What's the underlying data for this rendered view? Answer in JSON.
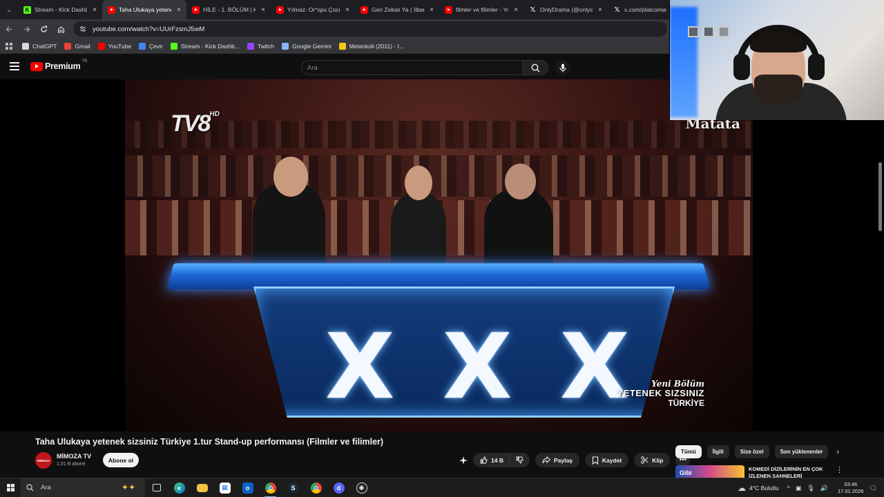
{
  "browser": {
    "tabs": [
      {
        "label": "Stream - Kick Dashb",
        "favicon": "kick",
        "active": false
      },
      {
        "label": "Taha Ulukaya yetene",
        "favicon": "youtube",
        "active": true
      },
      {
        "label": "HİLE - 1. BÖLÜM | K",
        "favicon": "youtube",
        "active": false
      },
      {
        "label": "Yılmaz: Or*spu Çocuğ",
        "favicon": "youtube",
        "active": false
      },
      {
        "label": "Geri Zekalı Ya ( İlber",
        "favicon": "youtube",
        "active": false
      },
      {
        "label": "filmler ve filimler - Yo",
        "favicon": "youtube",
        "active": false
      },
      {
        "label": "OnlyDrama (@onlyd",
        "favicon": "x",
        "active": false
      },
      {
        "label": "x.com/platcomw",
        "favicon": "x",
        "active": false
      }
    ],
    "close_glyph": "×",
    "url": "youtube.com/watch?v=UUrFzsmJ5wM",
    "bookmarks": [
      {
        "label": "ChatGPT",
        "icon": "chatgpt-icon",
        "color": "#d9d9d9"
      },
      {
        "label": "Gmail",
        "icon": "gmail-icon",
        "color": "#ea4335"
      },
      {
        "label": "YouTube",
        "icon": "youtube-icon",
        "color": "#ff0000"
      },
      {
        "label": "Çevir",
        "icon": "translate-icon",
        "color": "#4285f4"
      },
      {
        "label": "Stream - Kick Dashb...",
        "icon": "kick-icon",
        "color": "#53fc18"
      },
      {
        "label": "Twitch",
        "icon": "twitch-icon",
        "color": "#9146ff"
      },
      {
        "label": "Google Gemini",
        "icon": "gemini-icon",
        "color": "#8ab4f8"
      },
      {
        "label": "Melankoli (2011) - I...",
        "icon": "imdb-icon",
        "color": "#f5c518"
      }
    ]
  },
  "youtube": {
    "logo_text": "Premium",
    "country_code": "TR",
    "search_placeholder": "Ara",
    "video": {
      "title": "Taha Ulukaya yetenek sizsiniz Türkiye 1.tur Stand-up performansı (Filmler ve filimler)",
      "channel": "MİMOZA TV",
      "avatar_text": "MİMOZA",
      "subscribers": "1,01 B abone",
      "subscribe_label": "Abone ol",
      "likes": "14 B",
      "share_label": "Paylaş",
      "save_label": "Kaydet",
      "clip_label": "Klip",
      "overlay": {
        "channel_logo": "TV8",
        "channel_logo_suffix": "HD",
        "top_right_text": "Matata",
        "badge_line1": "Yeni Bölüm",
        "badge_line2": "YETENEK SIZSINIZ",
        "badge_line3": "TÜRKİYE"
      }
    },
    "chips": [
      {
        "label": "Tümü",
        "active": true
      },
      {
        "label": "İlgili",
        "active": false
      },
      {
        "label": "Size özel",
        "active": false
      },
      {
        "label": "Son yüklenenler",
        "active": false
      }
    ],
    "recommendation": {
      "thumb_text": "Gibi",
      "title": "KOMEDİ DİZİLERİNİN EN ÇOK İZLENEN SAHNELERİ"
    }
  },
  "taskbar": {
    "search_placeholder": "Ara",
    "apps": [
      "task-view-icon",
      "edge-icon",
      "file-explorer-icon",
      "store-icon",
      "outlook-icon",
      "chrome-icon",
      "steam-icon",
      "chrome-alt-icon",
      "discord-icon",
      "obs-icon"
    ],
    "weather": "4°C  Bulutlu",
    "time": "03:46",
    "date": "17.01.2026"
  },
  "colors": {
    "youtube_red": "#ff0000",
    "background": "#0f0f0f",
    "accent_blue": "#4aa6ff"
  }
}
